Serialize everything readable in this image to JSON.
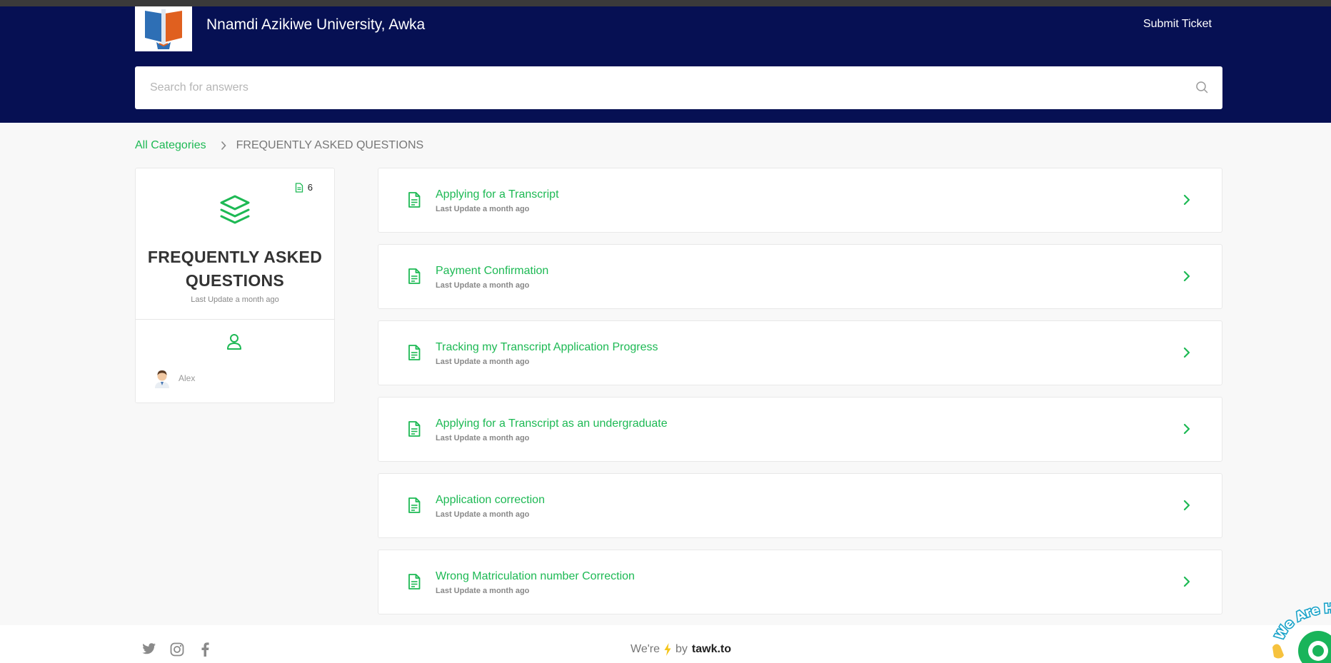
{
  "header": {
    "title": "Nnamdi Azikiwe University, Awka",
    "submit_ticket": "Submit Ticket",
    "bg_color": "#061053"
  },
  "search": {
    "placeholder": "Search for answers"
  },
  "breadcrumb": {
    "root": "All Categories",
    "current": "FREQUENTLY ASKED QUESTIONS"
  },
  "category": {
    "article_count": "6",
    "title": "FREQUENTLY ASKED QUESTIONS",
    "updated": "Last Update a month ago",
    "author": "Alex"
  },
  "articles": [
    {
      "title": "Applying for a Transcript",
      "updated": "Last Update a month ago"
    },
    {
      "title": "Payment Confirmation",
      "updated": "Last Update a month ago"
    },
    {
      "title": "Tracking my Transcript Application Progress",
      "updated": "Last Update a month ago"
    },
    {
      "title": "Applying for a Transcript as an undergraduate",
      "updated": "Last Update a month ago"
    },
    {
      "title": "Application correction",
      "updated": "Last Update a month ago"
    },
    {
      "title": "Wrong Matriculation number Correction",
      "updated": "Last Update a month ago"
    }
  ],
  "footer": {
    "powered_prefix": "We're",
    "powered_by": "by",
    "brand": "tawk.to",
    "social_icons": [
      "twitter-icon",
      "instagram-icon",
      "facebook-icon"
    ]
  },
  "chat_widget": {
    "text": "We Are Here!"
  },
  "colors": {
    "accent": "#1db954",
    "footer_bolt": "#f5c518"
  }
}
